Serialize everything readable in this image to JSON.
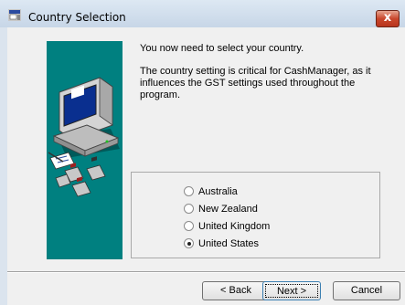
{
  "window": {
    "title": "Country Selection",
    "close_symbol": "x"
  },
  "messages": {
    "line1": "You now need to select your country.",
    "line2": "The country setting is critical for CashManager, as it influences the GST settings used throughout the program."
  },
  "countries": [
    {
      "label": "Australia",
      "selected": false
    },
    {
      "label": "New Zealand",
      "selected": false
    },
    {
      "label": "United Kingdom",
      "selected": false
    },
    {
      "label": "United States",
      "selected": true
    }
  ],
  "buttons": {
    "back": "< Back",
    "next": "Next >",
    "cancel": "Cancel"
  },
  "icons": {
    "title": "setup-app-icon",
    "wizard": "computer-with-disks-icon"
  },
  "colors": {
    "side_panel": "#008080",
    "close_button": "#c9472c"
  }
}
